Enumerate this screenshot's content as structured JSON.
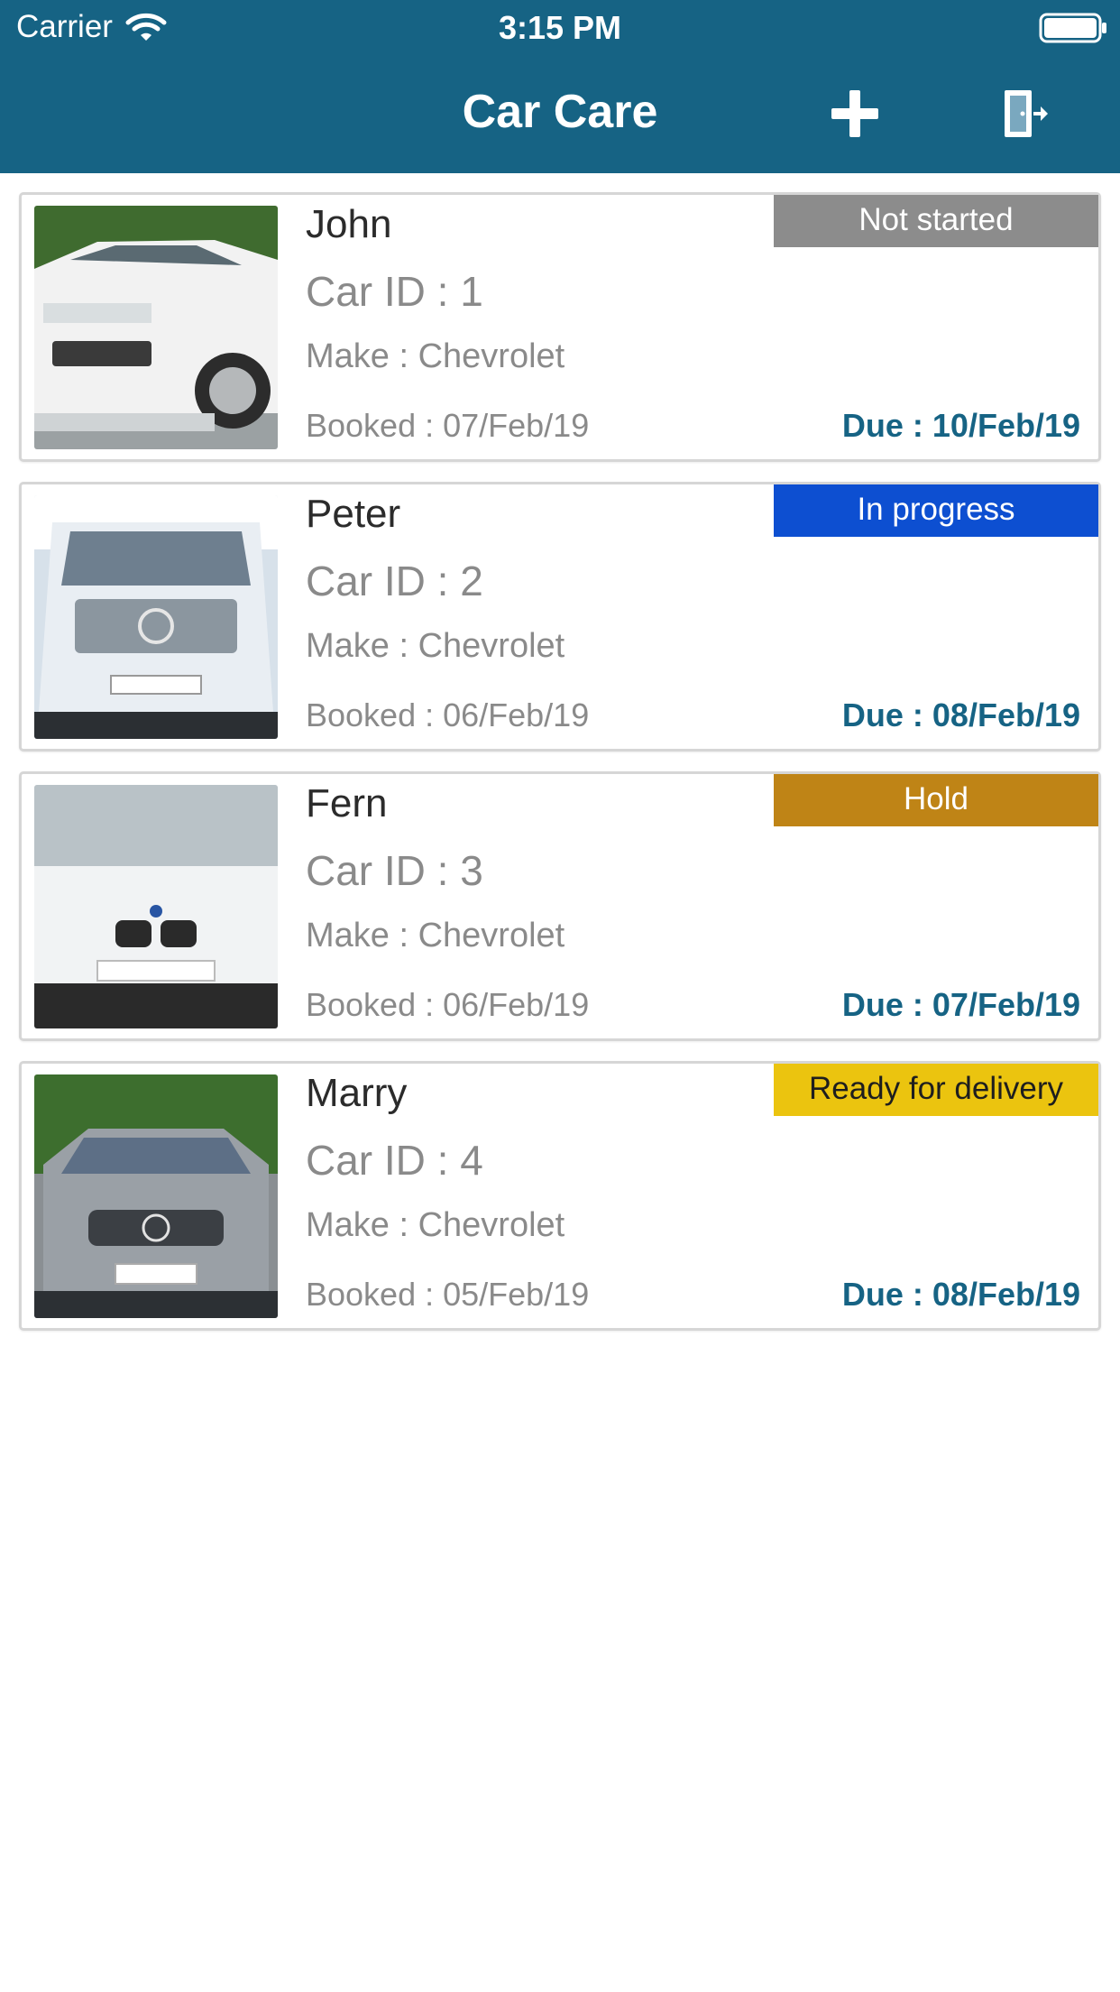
{
  "status_bar": {
    "carrier": "Carrier",
    "time": "3:15 PM"
  },
  "nav": {
    "title": "Car Care",
    "add_icon": "plus-icon",
    "exit_icon": "exit-door-icon"
  },
  "colors": {
    "header": "#166384",
    "due_text": "#166384",
    "not_started": "#8c8c8c",
    "in_progress": "#0d4fd1",
    "hold": "#bf8416",
    "ready": "#ebc40f"
  },
  "bookings": [
    {
      "name": "John",
      "car_id": "Car ID : 1",
      "make": "Make : Chevrolet",
      "booked": "Booked : 07/Feb/19",
      "due": "Due : 10/Feb/19",
      "status": "Not started"
    },
    {
      "name": "Peter",
      "car_id": "Car ID : 2",
      "make": "Make : Chevrolet",
      "booked": "Booked : 06/Feb/19",
      "due": "Due : 08/Feb/19",
      "status": "In progress"
    },
    {
      "name": "Fern",
      "car_id": "Car ID : 3",
      "make": "Make : Chevrolet",
      "booked": "Booked : 06/Feb/19",
      "due": "Due : 07/Feb/19",
      "status": "Hold"
    },
    {
      "name": "Marry",
      "car_id": "Car ID : 4",
      "make": "Make : Chevrolet",
      "booked": "Booked : 05/Feb/19",
      "due": "Due : 08/Feb/19",
      "status": "Ready for delivery"
    }
  ]
}
